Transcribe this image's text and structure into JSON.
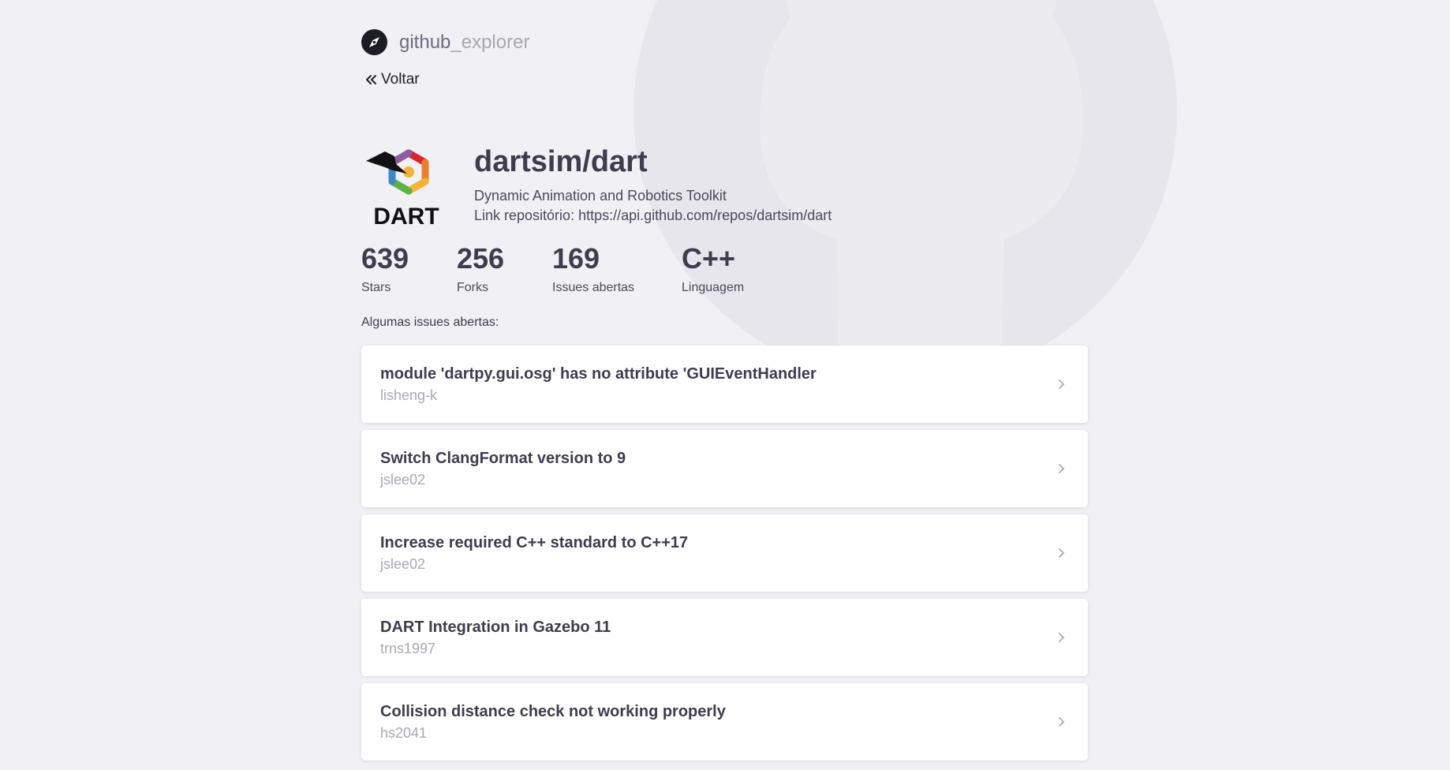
{
  "brand": {
    "name_bold": "github",
    "name_light": "_explorer",
    "icon": "compass-icon"
  },
  "nav": {
    "back_label": "Voltar",
    "back_icon": "double-chevron-left-icon"
  },
  "repo": {
    "full_name": "dartsim/dart",
    "description": "Dynamic Animation and Robotics Toolkit",
    "link": "Link repositório: https://api.github.com/repos/dartsim/dart",
    "logo_text": "DART"
  },
  "stats": [
    {
      "value": "639",
      "label": "Stars"
    },
    {
      "value": "256",
      "label": "Forks"
    },
    {
      "value": "169",
      "label": "Issues abertas"
    },
    {
      "value": "C++",
      "label": "Linguagem"
    }
  ],
  "issues_section_label": "Algumas issues abertas:",
  "issues": [
    {
      "title": "module 'dartpy.gui.osg' has no attribute 'GUIEventHandler",
      "author": "lisheng-k"
    },
    {
      "title": "Switch ClangFormat version to 9",
      "author": "jslee02"
    },
    {
      "title": "Increase required C++ standard to C++17",
      "author": "jslee02"
    },
    {
      "title": "DART Integration in Gazebo 11",
      "author": "trns1997"
    },
    {
      "title": "Collision distance check not working properly",
      "author": "hs2041"
    }
  ],
  "colors": {
    "background": "#f0f0f5",
    "title_text": "#3d3d4d",
    "muted_text": "#a8a8b3",
    "card_bg": "#ffffff"
  }
}
